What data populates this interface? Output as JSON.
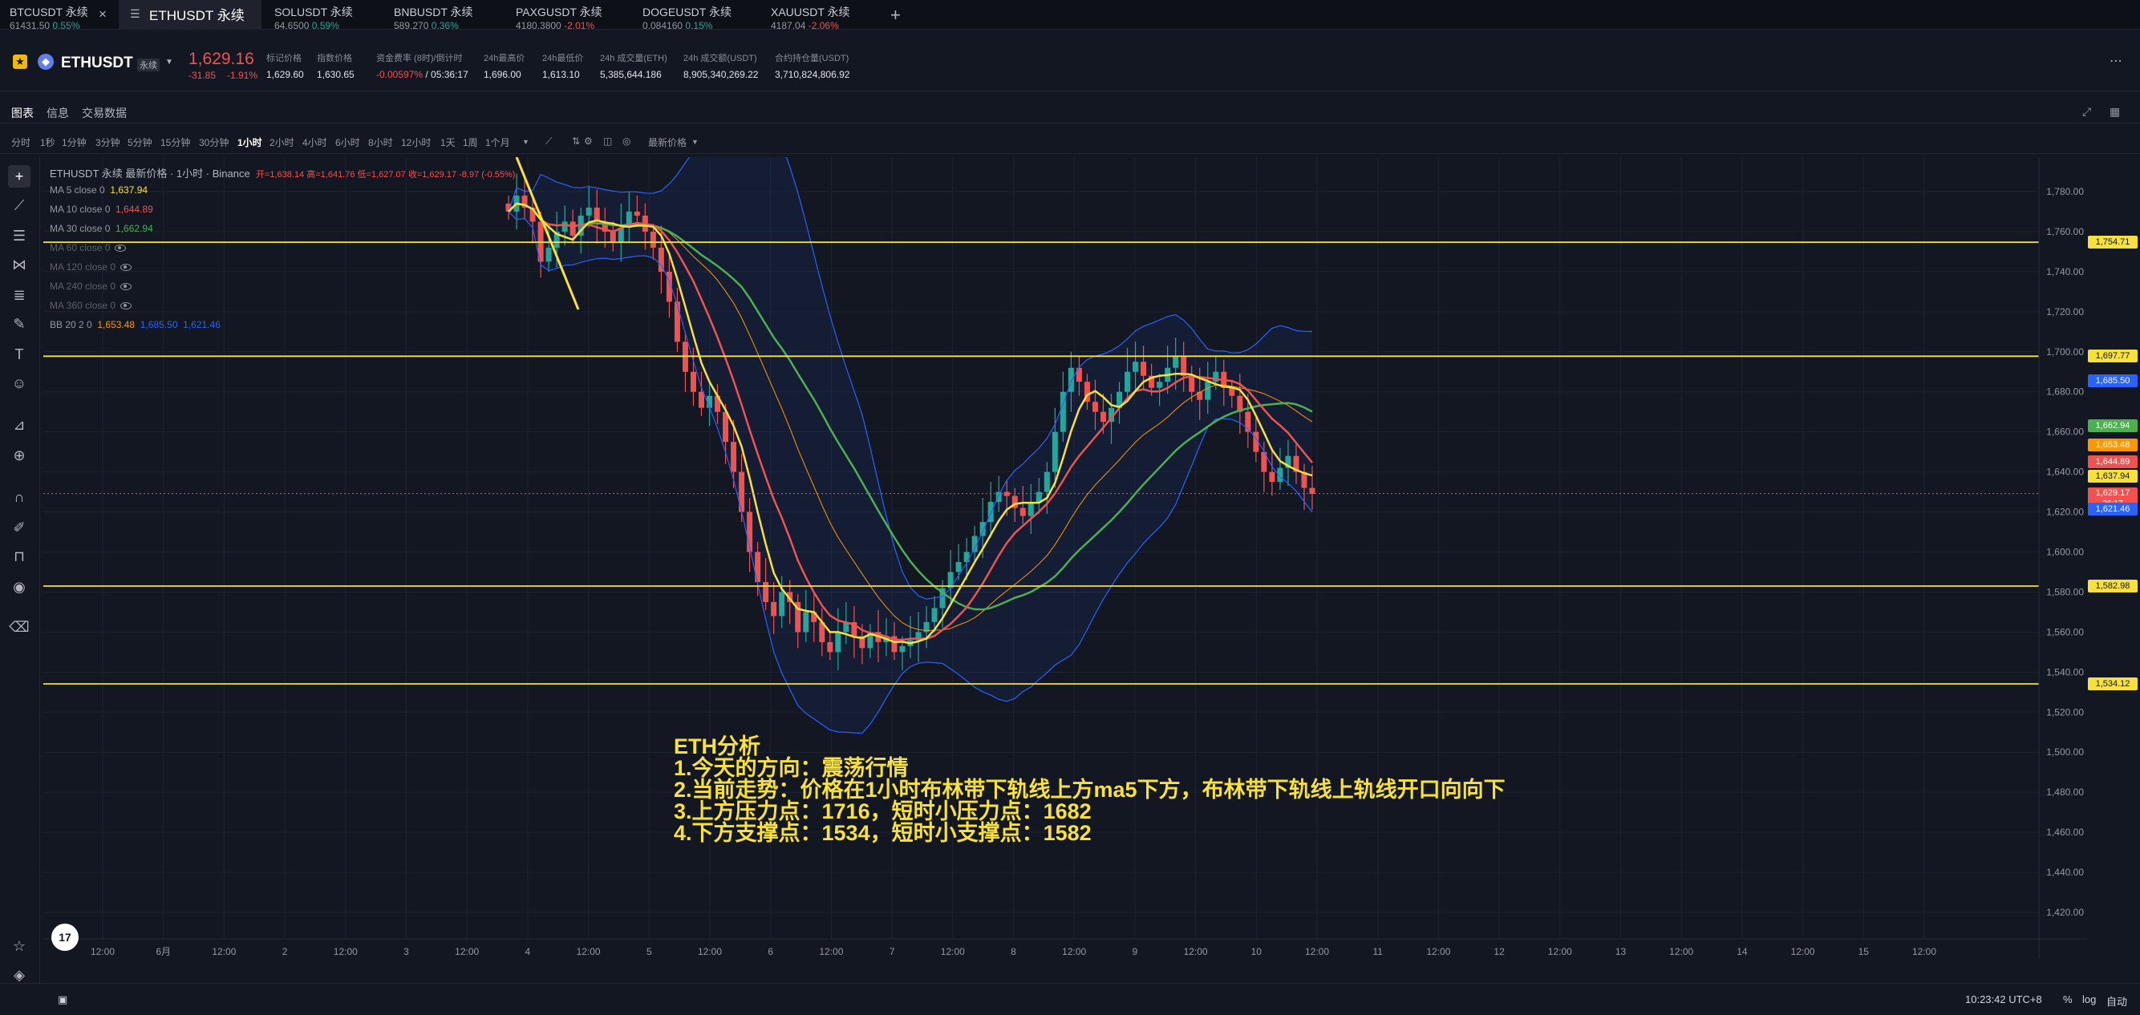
{
  "tabs": [
    {
      "symbol": "BTCUSDT 永续",
      "price": "61431.50",
      "change": "0.55%",
      "dir": "up"
    },
    {
      "symbol": "ETHUSDT 永续",
      "active": true
    },
    {
      "symbol": "SOLUSDT 永续",
      "price": "64.6500",
      "change": "0.59%",
      "dir": "up"
    },
    {
      "symbol": "BNBUSDT 永续",
      "price": "589.270",
      "change": "0.36%",
      "dir": "up"
    },
    {
      "symbol": "PAXGUSDT 永续",
      "price": "4180.3800",
      "change": "-2.01%",
      "dir": "dn"
    },
    {
      "symbol": "DOGEUSDT 永续",
      "price": "0.084160",
      "change": "0.15%",
      "dir": "up"
    },
    {
      "symbol": "XAUUSDT 永续",
      "price": "4187.04",
      "change": "-2.06%",
      "dir": "dn"
    }
  ],
  "header": {
    "symbol": "ETHUSDT",
    "tag": "永续",
    "price": "1,629.16",
    "change": "-31.85",
    "change_pct": "-1.91%",
    "stats": [
      {
        "label": "标记价格",
        "value": "1,629.60"
      },
      {
        "label": "指数价格",
        "value": "1,630.65"
      },
      {
        "label": "资金费率 (8时)/倒计时",
        "value": "-0.00597%",
        "value2": "/ 05:36:17"
      },
      {
        "label": "24h最高价",
        "value": "1,696.00"
      },
      {
        "label": "24h最低价",
        "value": "1,613.10"
      },
      {
        "label": "24h 成交量(ETH)",
        "value": "5,385,644.186"
      },
      {
        "label": "24h 成交额(USDT)",
        "value": "8,905,340,269.22"
      },
      {
        "label": "合约持仓量(USDT)",
        "value": "3,710,824,806.92"
      }
    ]
  },
  "subtabs": [
    "图表",
    "信息",
    "交易数据"
  ],
  "timeframes": [
    "分时",
    "1秒",
    "1分钟",
    "3分钟",
    "5分钟",
    "15分钟",
    "30分钟",
    "1小时",
    "2小时",
    "4小时",
    "6小时",
    "8小时",
    "12小时",
    "1天",
    "1周",
    "1个月"
  ],
  "active_timeframe": "1小时",
  "price_type": "最新价格",
  "legend": {
    "title": "ETHUSDT 永续 最新价格 · 1小时 · Binance",
    "ohlc": "开=1,638.14  高=1,641.76  低=1,627.07  收=1,629.17  -8.97 (-0.55%)",
    "ma": [
      {
        "label": "MA 5 close 0",
        "value": "1,637.94",
        "color": "#f7e13a"
      },
      {
        "label": "MA 10 close 0",
        "value": "1,644.89",
        "color": "#ef5350"
      },
      {
        "label": "MA 30 close 0",
        "value": "1,662.94",
        "color": "#4caf50"
      },
      {
        "label": "MA 60 close 0",
        "value": ""
      },
      {
        "label": "MA 120 close 0",
        "value": ""
      },
      {
        "label": "MA 240 close 0",
        "value": ""
      },
      {
        "label": "MA 360 close 0",
        "value": ""
      }
    ],
    "bb": {
      "label": "BB 20 2 0",
      "v1": "1,653.48",
      "v2": "1,685.50",
      "v3": "1,621.46"
    }
  },
  "analysis": [
    "ETH分析",
    "1.今天的方向：震荡行情",
    "2.当前走势：价格在1小时布林带下轨线上方ma5下方，布林带下轨线上轨线开口向向下",
    "3.上方压力点：1716，短时小压力点：1682",
    "4.下方支撑点：1534，短时小支撑点：1582"
  ],
  "chart_data": {
    "type": "candlestick",
    "y_ticks": [
      1780,
      1760,
      1740,
      1720,
      1700,
      1680,
      1660,
      1640,
      1620,
      1600,
      1580,
      1560,
      1540,
      1520,
      1500,
      1480,
      1460,
      1440,
      1420
    ],
    "x_ticks": [
      "12:00",
      "6月",
      "12:00",
      "2",
      "12:00",
      "3",
      "12:00",
      "4",
      "12:00",
      "5",
      "12:00",
      "6",
      "12:00",
      "7",
      "12:00",
      "8",
      "12:00",
      "9",
      "12:00",
      "10",
      "12:00",
      "11",
      "12:00",
      "12",
      "12:00",
      "13",
      "12:00",
      "14",
      "12:00",
      "15",
      "12:00"
    ],
    "horizontal_lines": [
      1754.71,
      1697.77,
      1582.98,
      1534.12
    ],
    "price_labels": [
      {
        "value": "1,754.71",
        "price": 1754.71,
        "bg": "#f7e13a",
        "fg": "#131722"
      },
      {
        "value": "1,697.77",
        "price": 1697.77,
        "bg": "#f7e13a",
        "fg": "#131722"
      },
      {
        "value": "1,685.50",
        "price": 1685.5,
        "bg": "#2962ff",
        "fg": "#ffffff"
      },
      {
        "value": "1,662.94",
        "price": 1662.94,
        "bg": "#4caf50",
        "fg": "#ffffff"
      },
      {
        "value": "1,653.48",
        "price": 1653.48,
        "bg": "#ff9800",
        "fg": "#ffffff"
      },
      {
        "value": "1,644.89",
        "price": 1644.89,
        "bg": "#ef5350",
        "fg": "#ffffff"
      },
      {
        "value": "1,637.94",
        "price": 1637.94,
        "bg": "#f7e13a",
        "fg": "#131722"
      },
      {
        "value": "1,629.17",
        "price": 1629.17,
        "bg": "#ef5350",
        "fg": "#ffffff",
        "sub": "36:17"
      },
      {
        "value": "1,621.46",
        "price": 1621.46,
        "bg": "#2962ff",
        "fg": "#ffffff"
      },
      {
        "value": "1,582.98",
        "price": 1582.98,
        "bg": "#f7e13a",
        "fg": "#131722"
      },
      {
        "value": "1,534.12",
        "price": 1534.12,
        "bg": "#f7e13a",
        "fg": "#131722"
      }
    ],
    "close_series": [
      1770,
      1778,
      1772,
      1765,
      1745,
      1752,
      1760,
      1765,
      1758,
      1768,
      1772,
      1765,
      1760,
      1755,
      1762,
      1770,
      1768,
      1760,
      1752,
      1740,
      1725,
      1705,
      1690,
      1680,
      1672,
      1678,
      1670,
      1655,
      1640,
      1620,
      1600,
      1585,
      1575,
      1568,
      1580,
      1575,
      1560,
      1570,
      1565,
      1555,
      1550,
      1560,
      1565,
      1558,
      1552,
      1560,
      1555,
      1558,
      1550,
      1553,
      1556,
      1560,
      1565,
      1572,
      1582,
      1590,
      1595,
      1600,
      1608,
      1615,
      1625,
      1630,
      1628,
      1622,
      1618,
      1625,
      1630,
      1640,
      1660,
      1680,
      1692,
      1685,
      1675,
      1670,
      1665,
      1672,
      1680,
      1690,
      1695,
      1688,
      1682,
      1685,
      1692,
      1698,
      1688,
      1680,
      1676,
      1685,
      1690,
      1682,
      1678,
      1670,
      1660,
      1650,
      1640,
      1635,
      1642,
      1648,
      1640,
      1632,
      1629
    ],
    "ohlc_last": {
      "open": 1638.14,
      "high": 1641.76,
      "low": 1627.07,
      "close": 1629.17
    }
  },
  "bottom": {
    "time": "10:23:42 UTC+8",
    "pct": "%",
    "log": "log",
    "auto": "自动"
  },
  "colors": {
    "up": "#26a69a",
    "down": "#ef5350",
    "ma5": "#f7e13a",
    "ma10": "#ef5350",
    "ma30": "#4caf50",
    "bb": "#2962ff"
  }
}
